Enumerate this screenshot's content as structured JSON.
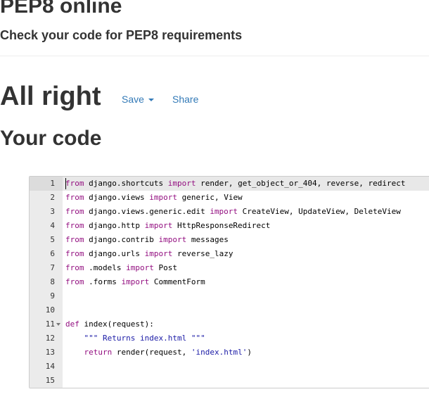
{
  "header": {
    "title": "PEP8 online",
    "subtitle": "Check your code for PEP8 requirements"
  },
  "result": {
    "heading": "All right",
    "save_label": "Save",
    "share_label": "Share"
  },
  "code_section": {
    "heading": "Your code"
  },
  "editor": {
    "active_line": 1,
    "lines": [
      {
        "number": "1",
        "tokens": [
          {
            "t": "from",
            "c": "kw"
          },
          {
            "t": " django.shortcuts "
          },
          {
            "t": "import",
            "c": "kw"
          },
          {
            "t": " render, get_object_or_404, reverse, redirect"
          }
        ]
      },
      {
        "number": "2",
        "tokens": [
          {
            "t": "from",
            "c": "kw"
          },
          {
            "t": " django.views "
          },
          {
            "t": "import",
            "c": "kw"
          },
          {
            "t": " generic, View"
          }
        ]
      },
      {
        "number": "3",
        "tokens": [
          {
            "t": "from",
            "c": "kw"
          },
          {
            "t": " django.views.generic.edit "
          },
          {
            "t": "import",
            "c": "kw"
          },
          {
            "t": " CreateView, UpdateView, DeleteView"
          }
        ]
      },
      {
        "number": "4",
        "tokens": [
          {
            "t": "from",
            "c": "kw"
          },
          {
            "t": " django.http "
          },
          {
            "t": "import",
            "c": "kw"
          },
          {
            "t": " HttpResponseRedirect"
          }
        ]
      },
      {
        "number": "5",
        "tokens": [
          {
            "t": "from",
            "c": "kw"
          },
          {
            "t": " django.contrib "
          },
          {
            "t": "import",
            "c": "kw"
          },
          {
            "t": " messages"
          }
        ]
      },
      {
        "number": "6",
        "tokens": [
          {
            "t": "from",
            "c": "kw"
          },
          {
            "t": " django.urls "
          },
          {
            "t": "import",
            "c": "kw"
          },
          {
            "t": " reverse_lazy"
          }
        ]
      },
      {
        "number": "7",
        "tokens": [
          {
            "t": "from",
            "c": "kw"
          },
          {
            "t": " .models "
          },
          {
            "t": "import",
            "c": "kw"
          },
          {
            "t": " Post"
          }
        ]
      },
      {
        "number": "8",
        "tokens": [
          {
            "t": "from",
            "c": "kw"
          },
          {
            "t": " .forms "
          },
          {
            "t": "import",
            "c": "kw"
          },
          {
            "t": " CommentForm"
          }
        ]
      },
      {
        "number": "9",
        "tokens": []
      },
      {
        "number": "10",
        "tokens": []
      },
      {
        "number": "11",
        "fold": true,
        "tokens": [
          {
            "t": "def",
            "c": "kw"
          },
          {
            "t": " index(request):"
          }
        ]
      },
      {
        "number": "12",
        "tokens": [
          {
            "t": "    "
          },
          {
            "t": "\"\"\" Returns index.html \"\"\"",
            "c": "str"
          }
        ]
      },
      {
        "number": "13",
        "tokens": [
          {
            "t": "    "
          },
          {
            "t": "return",
            "c": "kw"
          },
          {
            "t": " render(request, "
          },
          {
            "t": "'index.html'",
            "c": "str"
          },
          {
            "t": ")"
          }
        ]
      },
      {
        "number": "14",
        "tokens": []
      },
      {
        "number": "15",
        "tokens": []
      }
    ]
  }
}
